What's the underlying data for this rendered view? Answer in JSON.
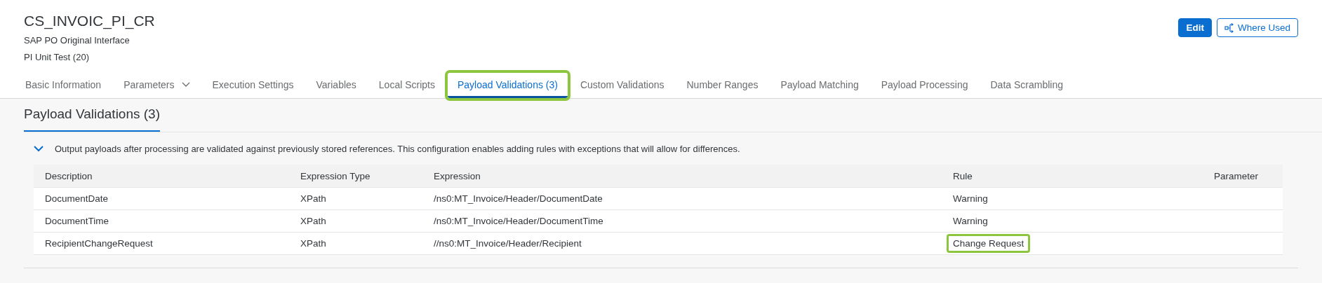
{
  "header": {
    "title": "CS_INVOIC_PI_CR",
    "subtitle": "SAP PO Original Interface",
    "context": "PI Unit Test (20)"
  },
  "actions": [
    {
      "label": "Edit",
      "kind": "primary"
    },
    {
      "label": "Where Used",
      "kind": "outline"
    }
  ],
  "tabs": [
    {
      "label": "Basic Information",
      "selected": false,
      "dropdown": false,
      "highlighted": false
    },
    {
      "label": "Parameters",
      "selected": false,
      "dropdown": true,
      "highlighted": false
    },
    {
      "label": "Execution Settings",
      "selected": false,
      "dropdown": false,
      "highlighted": false
    },
    {
      "label": "Variables",
      "selected": false,
      "dropdown": false,
      "highlighted": false
    },
    {
      "label": "Local Scripts",
      "selected": false,
      "dropdown": false,
      "highlighted": false
    },
    {
      "label": "Payload Validations (3)",
      "selected": true,
      "dropdown": false,
      "highlighted": true
    },
    {
      "label": "Custom Validations",
      "selected": false,
      "dropdown": false,
      "highlighted": false
    },
    {
      "label": "Number Ranges",
      "selected": false,
      "dropdown": false,
      "highlighted": false
    },
    {
      "label": "Payload Matching",
      "selected": false,
      "dropdown": false,
      "highlighted": false
    },
    {
      "label": "Payload Processing",
      "selected": false,
      "dropdown": false,
      "highlighted": false
    },
    {
      "label": "Data Scrambling",
      "selected": false,
      "dropdown": false,
      "highlighted": false
    }
  ],
  "section": {
    "title": "Payload Validations (3)",
    "expanded": true,
    "description": "Output payloads after processing are validated against previously stored references. This configuration enables adding rules with exceptions that will allow for differences."
  },
  "table": {
    "columns": [
      "Description",
      "Expression Type",
      "Expression",
      "Rule",
      "Parameter"
    ],
    "rows": [
      {
        "cells": [
          "DocumentDate",
          "XPath",
          "/ns0:MT_Invoice/Header/DocumentDate",
          "Warning"
        ],
        "highlighted": false
      },
      {
        "cells": [
          "DocumentTime",
          "XPath",
          "/ns0:MT_Invoice/Header/DocumentTime",
          "Warning"
        ],
        "highlighted": false
      },
      {
        "cells": [
          "RecipientChangeRequest",
          "XPath",
          "//ns0:MT_Invoice/Header/Recipient",
          "Change Request"
        ],
        "highlighted": true
      }
    ]
  }
}
